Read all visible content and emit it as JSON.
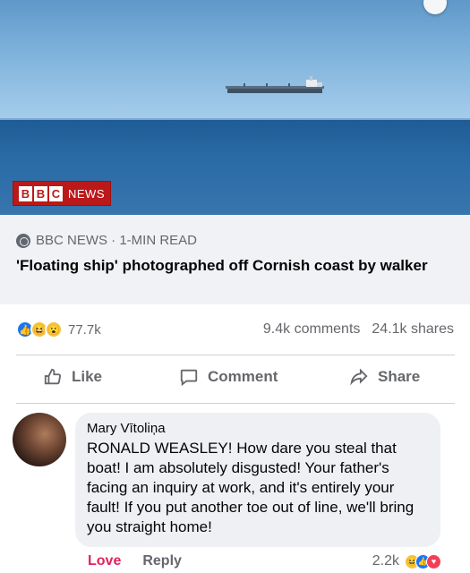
{
  "photo": {
    "logo_blocks": [
      "B",
      "B",
      "C"
    ],
    "logo_text": "NEWS",
    "colors": {
      "sky": "#7fb3dc",
      "sea": "#2a6aa6",
      "bbc_red": "#bb1919"
    }
  },
  "link_preview": {
    "source": "BBC NEWS · 1-MIN READ",
    "headline": "'Floating ship' photographed off Cornish coast by walker"
  },
  "stats": {
    "reaction_icons": [
      "like-icon",
      "haha-icon",
      "wow-icon"
    ],
    "reaction_count": "77.7k",
    "comments": "9.4k comments",
    "shares": "24.1k shares"
  },
  "actions": {
    "like": "Like",
    "comment": "Comment",
    "share": "Share"
  },
  "comment": {
    "author": "Mary Vītoliņa",
    "text": "RONALD WEASLEY! How dare you steal that boat! I am absolutely disgusted! Your father's facing an inquiry at work, and it's entirely your fault! If you put another toe out of line, we'll bring you straight home!",
    "love_label": "Love",
    "reply_label": "Reply",
    "reaction_count": "2.2k",
    "reaction_icons": [
      "haha-icon",
      "like-icon",
      "love-icon"
    ]
  }
}
